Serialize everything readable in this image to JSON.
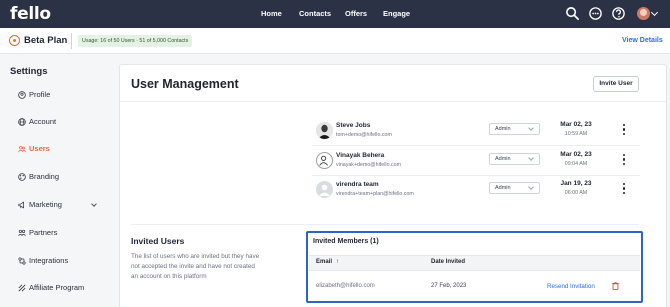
{
  "topbar": {
    "logo": "fello",
    "nav": [
      "Home",
      "Contacts",
      "Offers",
      "Engage"
    ],
    "icons": [
      "search-icon",
      "chat-icon",
      "help-icon",
      "user-avatar"
    ]
  },
  "plan": {
    "name": "Beta Plan",
    "usage": "Usage: 16 of 50 Users · 51 of 5,000 Contacts",
    "view_details": "View Details"
  },
  "sidebar": {
    "title": "Settings",
    "items": [
      {
        "label": "Profile",
        "icon": "profile-icon"
      },
      {
        "label": "Account",
        "icon": "globe-icon"
      },
      {
        "label": "Users",
        "icon": "users-icon",
        "active": true
      },
      {
        "label": "Branding",
        "icon": "palette-icon"
      },
      {
        "label": "Marketing",
        "icon": "megaphone-icon",
        "expandable": true
      },
      {
        "label": "Partners",
        "icon": "partners-icon"
      },
      {
        "label": "Integrations",
        "icon": "integrations-icon"
      },
      {
        "label": "Affiliate Program",
        "icon": "affiliate-icon"
      }
    ]
  },
  "main": {
    "title": "User Management",
    "invite_button": "Invite User",
    "users": [
      {
        "name": "Steve Jobs",
        "email": "tom+demo@hifello.com",
        "role": "Admin",
        "date": "Mar 02, 23",
        "time": "10:59 AM"
      },
      {
        "name": "Vinayak Behera",
        "email": "vinayak+demo@hifello.com",
        "role": "Admin",
        "date": "Mar 02, 23",
        "time": "09:04 AM"
      },
      {
        "name": "virendra team",
        "email": "virendra+team+plan@hifello.com",
        "role": "Admin",
        "date": "Jan 19, 23",
        "time": "06:00 AM"
      }
    ],
    "invited": {
      "title": "Invited Users",
      "description": "The list of users who are invited but they have not accepted the invite and have not created an account on this platform",
      "panel_title": "Invited Members (1)",
      "columns": {
        "email": "Email",
        "sort_arrow": "↑",
        "date": "Date Invited"
      },
      "rows": [
        {
          "email": "elizabeth@hifello.com",
          "date": "27 Feb, 2023",
          "action": "Resend Invitation"
        }
      ]
    }
  },
  "colors": {
    "nav_bg": "#2b3245",
    "accent": "#e8663d",
    "link": "#2a6fdb",
    "highlight_border": "#2e64c8"
  }
}
